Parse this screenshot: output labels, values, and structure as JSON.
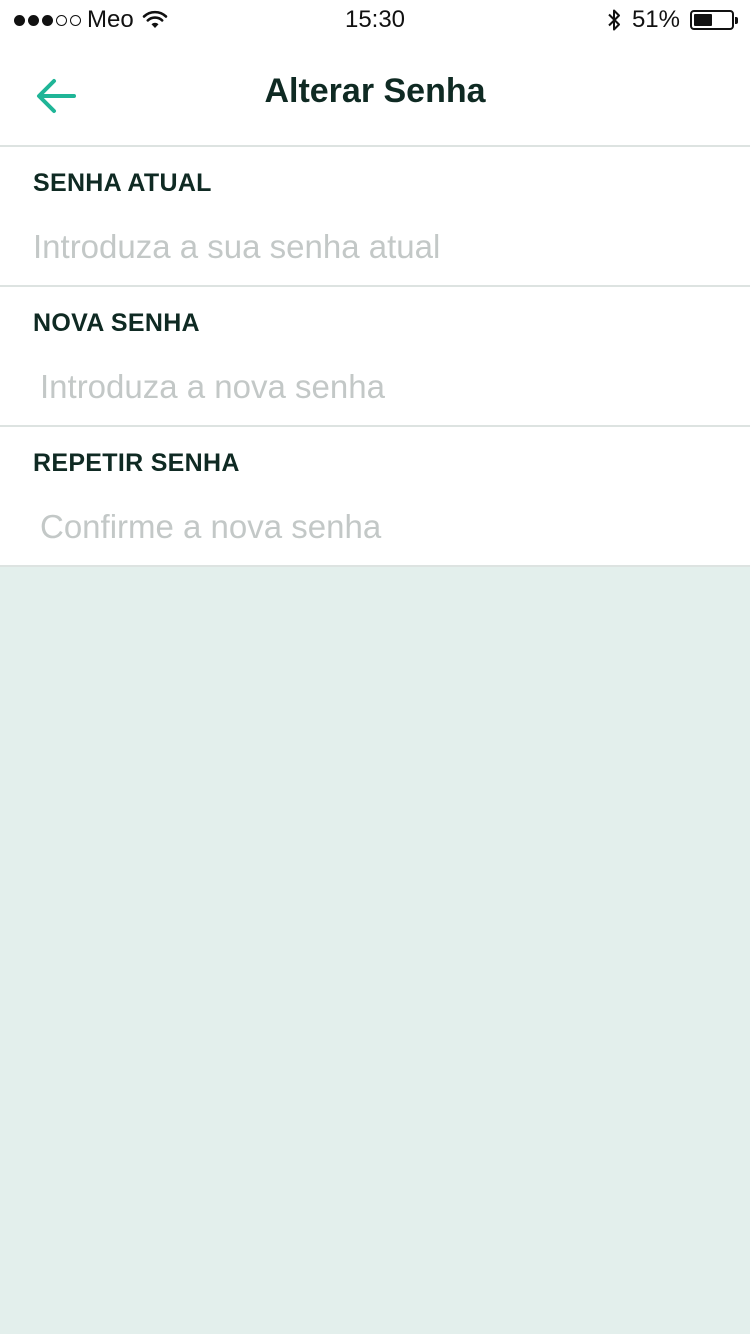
{
  "statusbar": {
    "carrier": "Meo",
    "time": "15:30",
    "battery_pct": "51%",
    "battery_level": 0.51,
    "signal_bars_filled": 3,
    "signal_bars_total": 5
  },
  "header": {
    "title": "Alterar Senha",
    "back_icon": "arrow-left-icon",
    "accent_color": "#1fb597"
  },
  "form": {
    "current": {
      "label": "SENHA ATUAL",
      "placeholder": "Introduza a sua senha atual",
      "value": ""
    },
    "new": {
      "label": "NOVA SENHA",
      "placeholder": "Introduza a nova senha",
      "value": ""
    },
    "repeat": {
      "label": "REPETIR SENHA",
      "placeholder": "Confirme a nova senha",
      "value": ""
    }
  },
  "colors": {
    "background": "#e3efec",
    "text_dark": "#0f2a23",
    "placeholder": "#c3c8c7"
  }
}
